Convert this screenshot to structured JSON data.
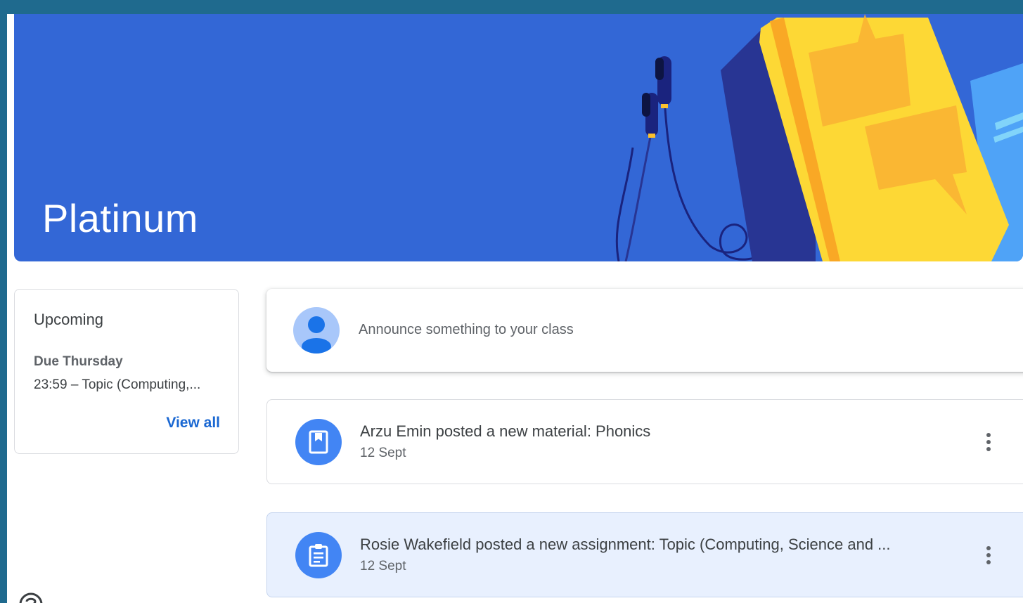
{
  "banner": {
    "class_name": "Platinum",
    "color": "#3367d6"
  },
  "upcoming": {
    "title": "Upcoming",
    "due_label": "Due Thursday",
    "due_item": "23:59 – Topic (Computing,...",
    "view_all": "View all"
  },
  "announce": {
    "placeholder": "Announce something to your class"
  },
  "stream": [
    {
      "icon": "material-bookmark-icon",
      "title": "Arzu Emin posted a new material: Phonics",
      "date": "12 Sept"
    },
    {
      "icon": "assignment-clipboard-icon",
      "title": "Rosie Wakefield posted a new assignment: Topic (Computing, Science and ...",
      "date": "12 Sept"
    }
  ],
  "colors": {
    "accent": "#1967d2",
    "icon_bg": "#4285f4",
    "highlight_bg": "#e8f0fe",
    "frame": "#1f6a8e"
  }
}
